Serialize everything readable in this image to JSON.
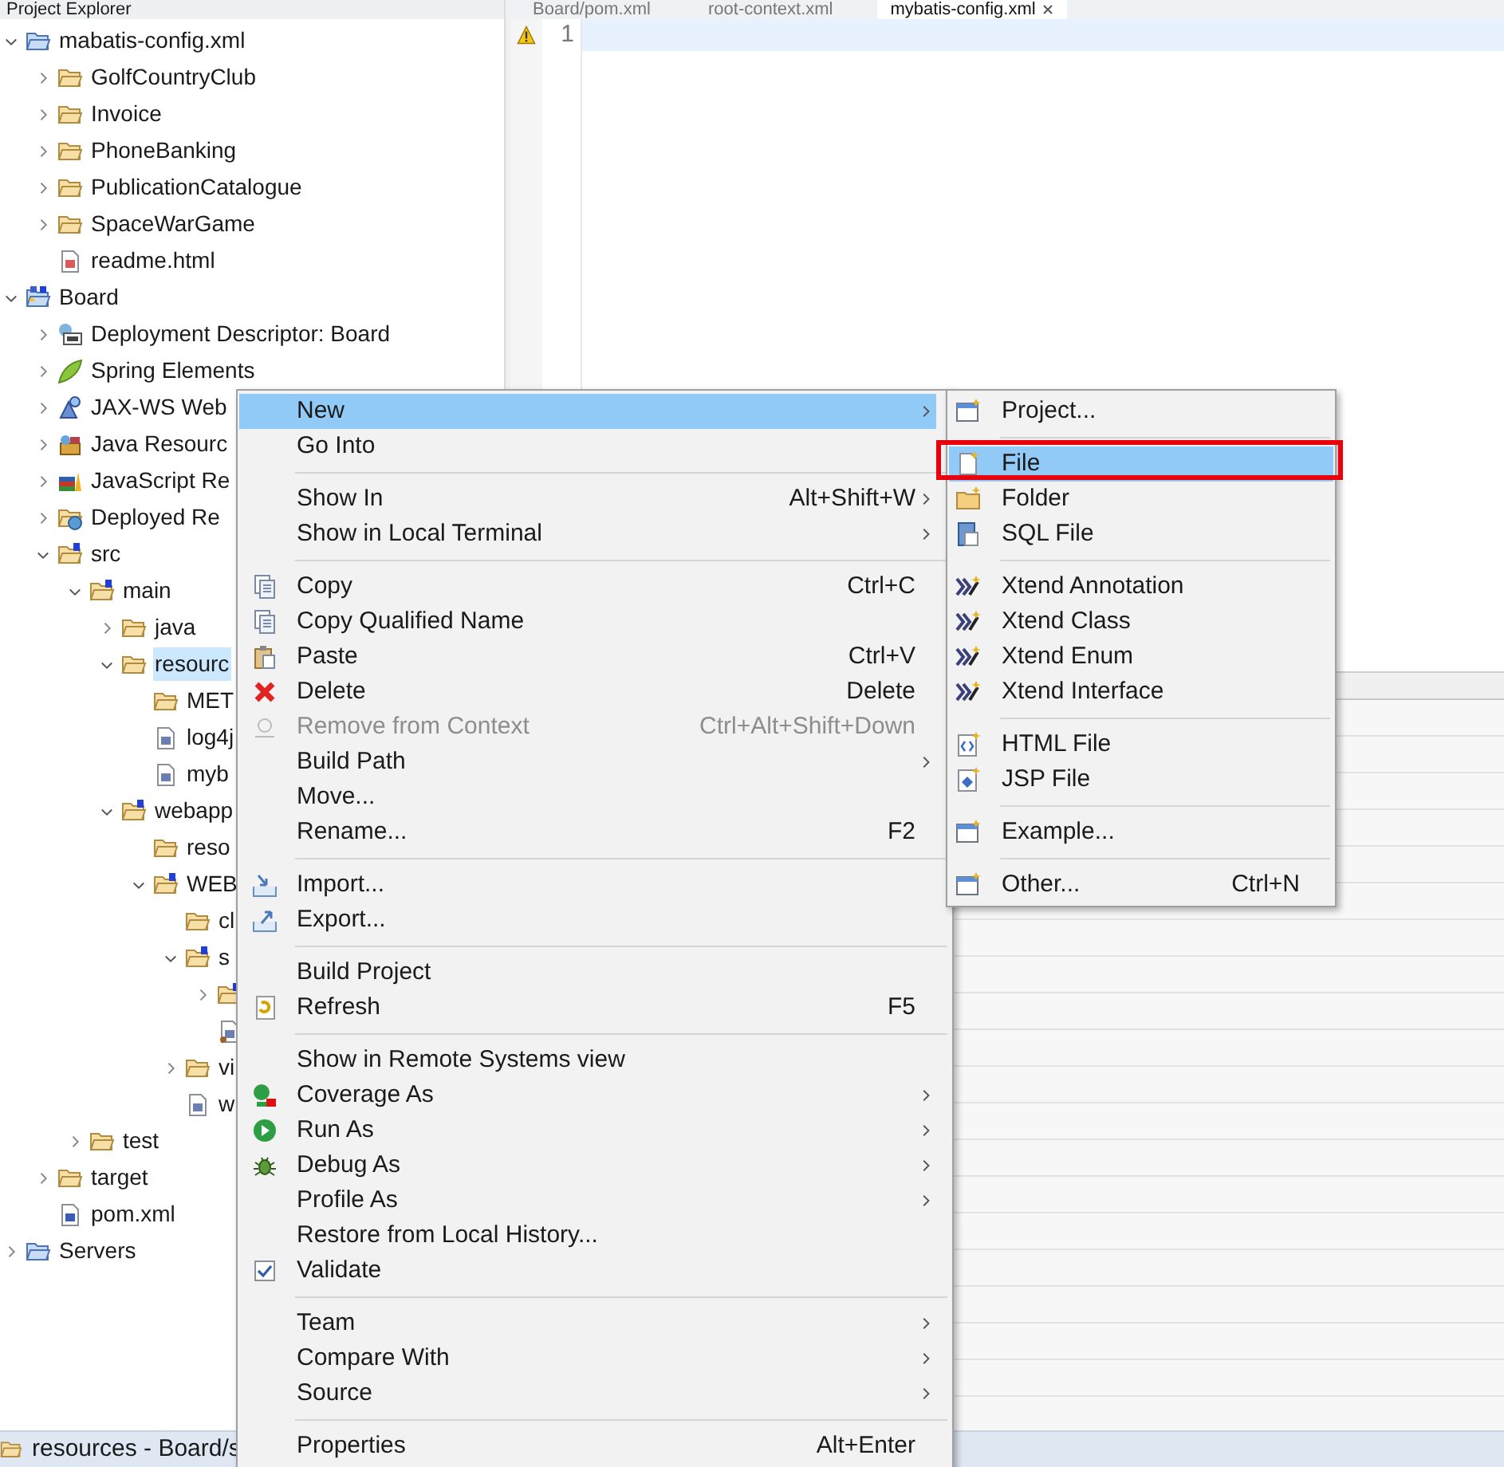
{
  "explorer": {
    "title": "Project Explorer",
    "tree": [
      {
        "label": "mabatis-config.xml",
        "kind": "working-set",
        "expanded": true,
        "selected": false,
        "children": [
          {
            "label": "GolfCountryClub",
            "kind": "folder",
            "expanded": false,
            "selected": false
          },
          {
            "label": "Invoice",
            "kind": "folder",
            "expanded": false,
            "selected": false
          },
          {
            "label": "PhoneBanking",
            "kind": "folder",
            "expanded": false,
            "selected": false
          },
          {
            "label": "PublicationCatalogue",
            "kind": "folder",
            "expanded": false,
            "selected": false
          },
          {
            "label": "SpaceWarGame",
            "kind": "folder",
            "expanded": false,
            "selected": false
          },
          {
            "label": "readme.html",
            "kind": "html-file",
            "selected": false
          }
        ]
      },
      {
        "label": "Board",
        "kind": "project",
        "expanded": true,
        "selected": false,
        "children": [
          {
            "label": "Deployment Descriptor: Board",
            "kind": "descriptor",
            "expanded": false,
            "selected": false
          },
          {
            "label": "Spring Elements",
            "kind": "spring",
            "expanded": false,
            "selected": false
          },
          {
            "label": "JAX-WS Web",
            "kind": "web-services",
            "expanded": false,
            "selected": false
          },
          {
            "label": "Java Resourc",
            "kind": "java-resources",
            "expanded": false,
            "selected": false
          },
          {
            "label": "JavaScript Re",
            "kind": "javascript",
            "expanded": false,
            "selected": false
          },
          {
            "label": "Deployed Re",
            "kind": "deployed",
            "expanded": false,
            "selected": false
          },
          {
            "label": "src",
            "kind": "source-folder",
            "expanded": true,
            "selected": false,
            "children": [
              {
                "label": "main",
                "kind": "source-folder",
                "expanded": true,
                "selected": false,
                "children": [
                  {
                    "label": "java",
                    "kind": "folder",
                    "expanded": false,
                    "selected": false
                  },
                  {
                    "label": "resourc",
                    "kind": "folder",
                    "expanded": true,
                    "selected": true,
                    "children": [
                      {
                        "label": "MET",
                        "kind": "folder",
                        "selected": false
                      },
                      {
                        "label": "log4j",
                        "kind": "xml-file",
                        "selected": false
                      },
                      {
                        "label": "myb",
                        "kind": "xml-file",
                        "selected": false
                      }
                    ]
                  },
                  {
                    "label": "webapp",
                    "kind": "source-folder",
                    "expanded": true,
                    "selected": false,
                    "children": [
                      {
                        "label": "reso",
                        "kind": "folder",
                        "selected": false
                      },
                      {
                        "label": "WEB",
                        "kind": "source-folder",
                        "expanded": true,
                        "selected": false,
                        "children": [
                          {
                            "label": "cl",
                            "kind": "folder",
                            "selected": false
                          },
                          {
                            "label": "s",
                            "kind": "source-folder",
                            "expanded": true,
                            "selected": false,
                            "children": [
                              {
                                "kind": "source-folder",
                                "expanded": false,
                                "selected": false
                              },
                              {
                                "kind": "spring-file",
                                "selected": false
                              }
                            ]
                          },
                          {
                            "label": "vi",
                            "kind": "folder",
                            "expanded": false,
                            "selected": false
                          },
                          {
                            "label": "w",
                            "kind": "xml-file",
                            "selected": false
                          }
                        ]
                      }
                    ]
                  }
                ]
              },
              {
                "label": "test",
                "kind": "folder",
                "expanded": false,
                "selected": false
              }
            ]
          },
          {
            "label": "target",
            "kind": "folder",
            "expanded": false,
            "selected": false
          },
          {
            "label": "pom.xml",
            "kind": "pom-file",
            "selected": false
          }
        ]
      },
      {
        "label": "Servers",
        "kind": "working-set",
        "expanded": false,
        "selected": false
      }
    ]
  },
  "editor": {
    "tabs": [
      {
        "label": "Board/pom.xml",
        "selected": false
      },
      {
        "label": "root-context.xml",
        "selected": false
      },
      {
        "label": "mybatis-config.xml",
        "selected": true
      }
    ],
    "lines": [
      {
        "number": "1",
        "warning": true,
        "current": true
      }
    ]
  },
  "status_bar": {
    "text": "resources - Board/s"
  },
  "context_menu": {
    "items": [
      {
        "kind": "item",
        "label": "New",
        "submenu": true,
        "selected": true,
        "disabled": false
      },
      {
        "kind": "item",
        "label": "Go Into",
        "submenu": false,
        "selected": false,
        "disabled": false
      },
      {
        "kind": "separator"
      },
      {
        "kind": "item",
        "label": "Show In",
        "shortcut": "Alt+Shift+W",
        "submenu": true,
        "selected": false,
        "disabled": false
      },
      {
        "kind": "item",
        "label": "Show in Local Terminal",
        "submenu": true,
        "selected": false,
        "disabled": false
      },
      {
        "kind": "separator"
      },
      {
        "kind": "item",
        "label": "Copy",
        "shortcut": "Ctrl+C",
        "submenu": false,
        "selected": false,
        "disabled": false
      },
      {
        "kind": "item",
        "label": "Copy Qualified Name",
        "submenu": false,
        "selected": false,
        "disabled": false
      },
      {
        "kind": "item",
        "label": "Paste",
        "shortcut": "Ctrl+V",
        "submenu": false,
        "selected": false,
        "disabled": false
      },
      {
        "kind": "item",
        "label": "Delete",
        "shortcut": "Delete",
        "submenu": false,
        "selected": false,
        "disabled": false
      },
      {
        "kind": "item",
        "label": "Remove from Context",
        "shortcut": "Ctrl+Alt+Shift+Down",
        "submenu": false,
        "selected": false,
        "disabled": true
      },
      {
        "kind": "item",
        "label": "Build Path",
        "submenu": true,
        "selected": false,
        "disabled": false
      },
      {
        "kind": "item",
        "label": "Move...",
        "submenu": false,
        "selected": false,
        "disabled": false
      },
      {
        "kind": "item",
        "label": "Rename...",
        "shortcut": "F2",
        "submenu": false,
        "selected": false,
        "disabled": false
      },
      {
        "kind": "separator"
      },
      {
        "kind": "item",
        "label": "Import...",
        "submenu": false,
        "selected": false,
        "disabled": false
      },
      {
        "kind": "item",
        "label": "Export...",
        "submenu": false,
        "selected": false,
        "disabled": false
      },
      {
        "kind": "separator"
      },
      {
        "kind": "item",
        "label": "Build Project",
        "submenu": false,
        "selected": false,
        "disabled": false
      },
      {
        "kind": "item",
        "label": "Refresh",
        "shortcut": "F5",
        "submenu": false,
        "selected": false,
        "disabled": false
      },
      {
        "kind": "separator"
      },
      {
        "kind": "item",
        "label": "Show in Remote Systems view",
        "submenu": false,
        "selected": false,
        "disabled": false
      },
      {
        "kind": "item",
        "label": "Coverage As",
        "submenu": true,
        "selected": false,
        "disabled": false
      },
      {
        "kind": "item",
        "label": "Run As",
        "submenu": true,
        "selected": false,
        "disabled": false
      },
      {
        "kind": "item",
        "label": "Debug As",
        "submenu": true,
        "selected": false,
        "disabled": false
      },
      {
        "kind": "item",
        "label": "Profile As",
        "submenu": true,
        "selected": false,
        "disabled": false
      },
      {
        "kind": "item",
        "label": "Restore from Local History...",
        "submenu": false,
        "selected": false,
        "disabled": false
      },
      {
        "kind": "item",
        "label": "Validate",
        "submenu": false,
        "selected": false,
        "disabled": false
      },
      {
        "kind": "separator"
      },
      {
        "kind": "item",
        "label": "Team",
        "submenu": true,
        "selected": false,
        "disabled": false
      },
      {
        "kind": "item",
        "label": "Compare With",
        "submenu": true,
        "selected": false,
        "disabled": false
      },
      {
        "kind": "item",
        "label": "Source",
        "submenu": true,
        "selected": false,
        "disabled": false
      },
      {
        "kind": "separator"
      },
      {
        "kind": "item",
        "label": "Properties",
        "shortcut": "Alt+Enter",
        "submenu": false,
        "selected": false,
        "disabled": false
      }
    ]
  },
  "new_submenu": {
    "items": [
      {
        "kind": "item",
        "label": "Project...",
        "selected": false
      },
      {
        "kind": "separator"
      },
      {
        "kind": "item",
        "label": "File",
        "selected": true
      },
      {
        "kind": "item",
        "label": "Folder",
        "selected": false
      },
      {
        "kind": "item",
        "label": "SQL File",
        "selected": false
      },
      {
        "kind": "separator"
      },
      {
        "kind": "item",
        "label": "Xtend Annotation",
        "selected": false
      },
      {
        "kind": "item",
        "label": "Xtend Class",
        "selected": false
      },
      {
        "kind": "item",
        "label": "Xtend Enum",
        "selected": false
      },
      {
        "kind": "item",
        "label": "Xtend Interface",
        "selected": false
      },
      {
        "kind": "separator"
      },
      {
        "kind": "item",
        "label": "HTML File",
        "selected": false
      },
      {
        "kind": "item",
        "label": "JSP File",
        "selected": false
      },
      {
        "kind": "separator"
      },
      {
        "kind": "item",
        "label": "Example...",
        "selected": false
      },
      {
        "kind": "separator"
      },
      {
        "kind": "item",
        "label": "Other...",
        "shortcut": "Ctrl+N",
        "selected": false
      }
    ]
  }
}
